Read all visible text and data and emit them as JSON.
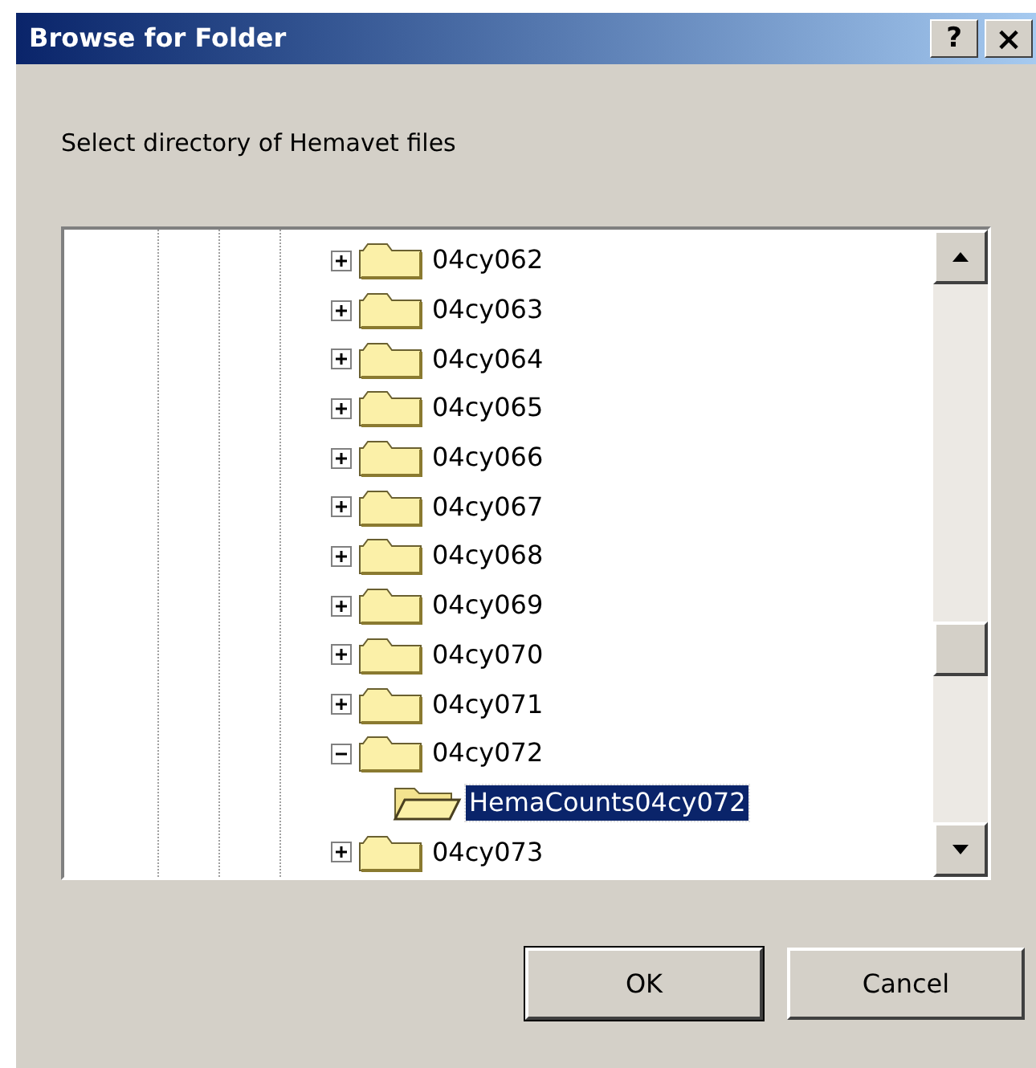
{
  "window": {
    "title": "Browse for Folder",
    "help_button": "?",
    "close_button": "×"
  },
  "prompt": "Select directory of Hemavet files",
  "tree": [
    {
      "label": "04cy062",
      "expanded": false,
      "selected": false
    },
    {
      "label": "04cy063",
      "expanded": false,
      "selected": false
    },
    {
      "label": "04cy064",
      "expanded": false,
      "selected": false
    },
    {
      "label": "04cy065",
      "expanded": false,
      "selected": false
    },
    {
      "label": "04cy066",
      "expanded": false,
      "selected": false
    },
    {
      "label": "04cy067",
      "expanded": false,
      "selected": false
    },
    {
      "label": "04cy068",
      "expanded": false,
      "selected": false
    },
    {
      "label": "04cy069",
      "expanded": false,
      "selected": false
    },
    {
      "label": "04cy070",
      "expanded": false,
      "selected": false
    },
    {
      "label": "04cy071",
      "expanded": false,
      "selected": false
    },
    {
      "label": "04cy072",
      "expanded": true,
      "selected": false,
      "children": [
        {
          "label": "HemaCounts04cy072",
          "selected": true
        }
      ]
    },
    {
      "label": "04cy073",
      "expanded": false,
      "selected": false
    }
  ],
  "buttons": [
    {
      "label": "OK",
      "default": true
    },
    {
      "label": "Cancel",
      "default": false
    }
  ]
}
